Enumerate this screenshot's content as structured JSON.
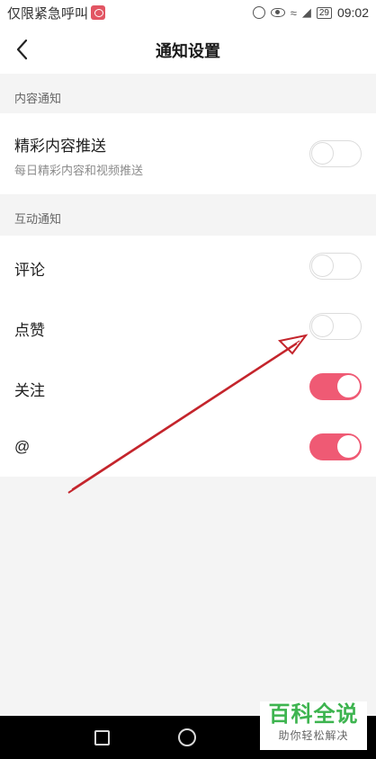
{
  "status_bar": {
    "carrier": "仅限紧急呼叫",
    "battery": "29",
    "time": "09:02"
  },
  "header": {
    "title": "通知设置"
  },
  "sections": [
    {
      "title": "内容通知",
      "items": [
        {
          "label": "精彩内容推送",
          "description": "每日精彩内容和视频推送",
          "enabled": false
        }
      ]
    },
    {
      "title": "互动通知",
      "items": [
        {
          "label": "评论",
          "enabled": false
        },
        {
          "label": "点赞",
          "enabled": false
        },
        {
          "label": "关注",
          "enabled": true
        },
        {
          "label": "@",
          "enabled": true
        }
      ]
    }
  ],
  "colors": {
    "toggle_on": "#ef5a74",
    "annotation_arrow": "#c4252c",
    "watermark_green": "#3db44f"
  },
  "watermark": {
    "title": "百科全说",
    "subtitle": "助你轻松解决"
  }
}
